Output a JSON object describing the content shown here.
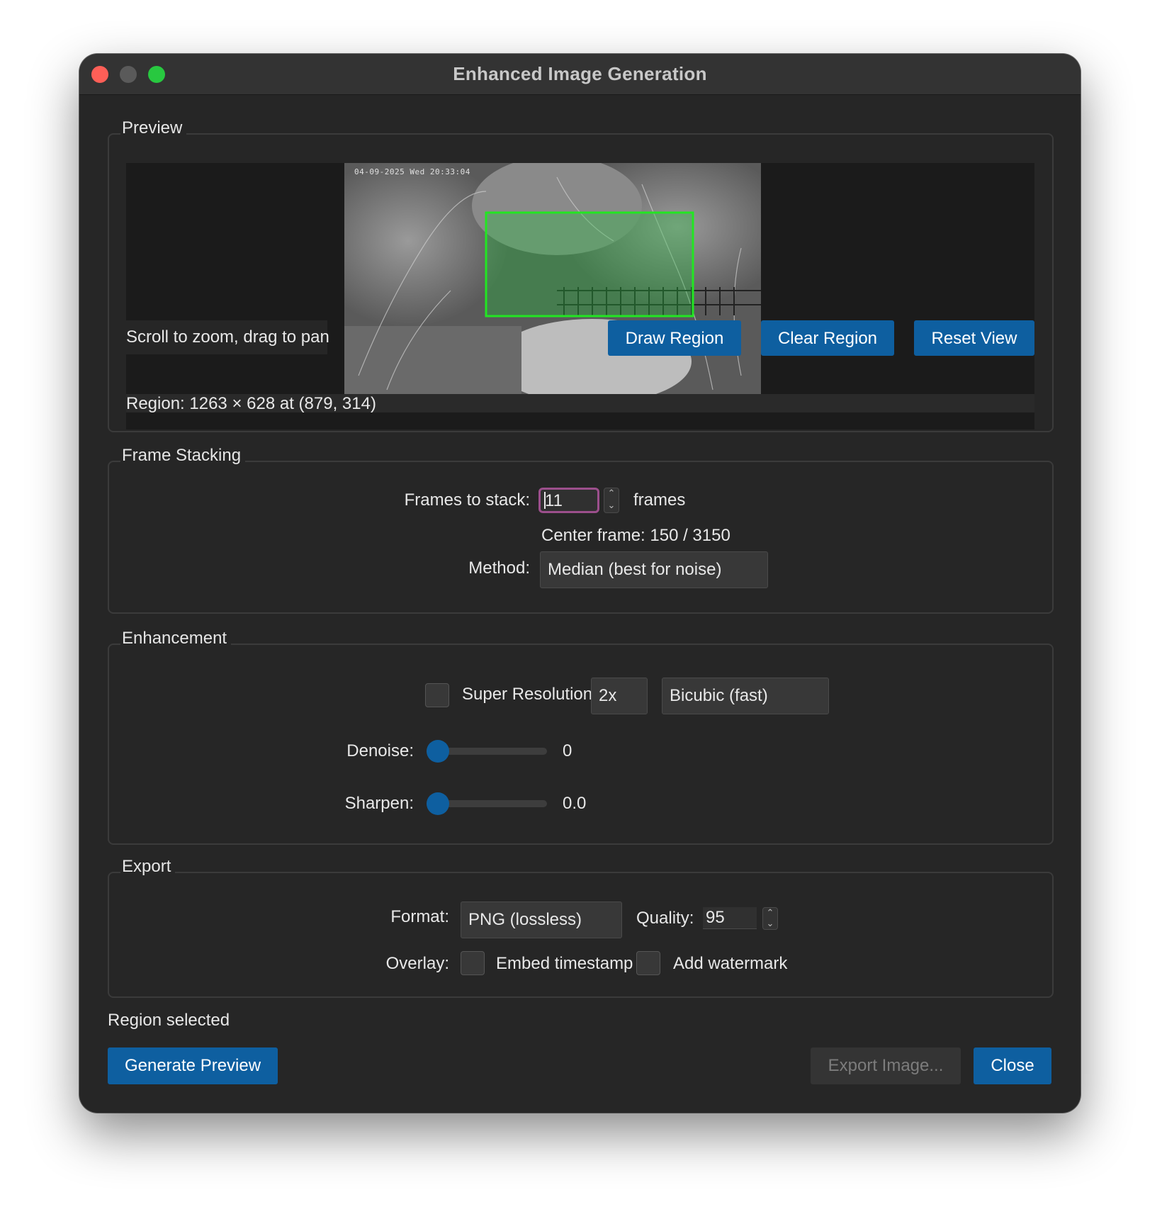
{
  "window": {
    "title": "Enhanced Image Generation"
  },
  "preview": {
    "group_title": "Preview",
    "timestamp": "04-09-2025 Wed 20:33:04",
    "hint": "Scroll to zoom, drag to pan",
    "region_info": "Region: 1263 × 628 at (879, 314)",
    "buttons": {
      "draw": "Draw Region",
      "clear": "Clear Region",
      "reset": "Reset View"
    }
  },
  "frame_stacking": {
    "group_title": "Frame Stacking",
    "frames_label": "Frames to stack:",
    "frames_value": "11",
    "frames_unit": "frames",
    "center_frame": "Center frame: 150 / 3150",
    "method_label": "Method:",
    "method_value": "Median (best for noise)"
  },
  "enhancement": {
    "group_title": "Enhancement",
    "super_resolution_label": "Super Resolution",
    "super_resolution_checked": false,
    "scale_value": "2x",
    "algorithm_value": "Bicubic (fast)",
    "denoise_label": "Denoise:",
    "denoise_value": "0",
    "denoise_level": 0,
    "sharpen_label": "Sharpen:",
    "sharpen_value": "0.0",
    "sharpen_level": 0
  },
  "export": {
    "group_title": "Export",
    "format_label": "Format:",
    "format_value": "PNG (lossless)",
    "quality_label": "Quality:",
    "quality_value": "95",
    "overlay_label": "Overlay:",
    "embed_timestamp_label": "Embed timestamp",
    "embed_timestamp_checked": false,
    "add_watermark_label": "Add watermark",
    "add_watermark_checked": false
  },
  "status": "Region selected",
  "footer": {
    "generate": "Generate Preview",
    "export": "Export Image...",
    "close": "Close"
  },
  "colors": {
    "accent": "#0e5fa0",
    "region_box": "#22e622",
    "focus_ring": "#9c4f8c"
  }
}
